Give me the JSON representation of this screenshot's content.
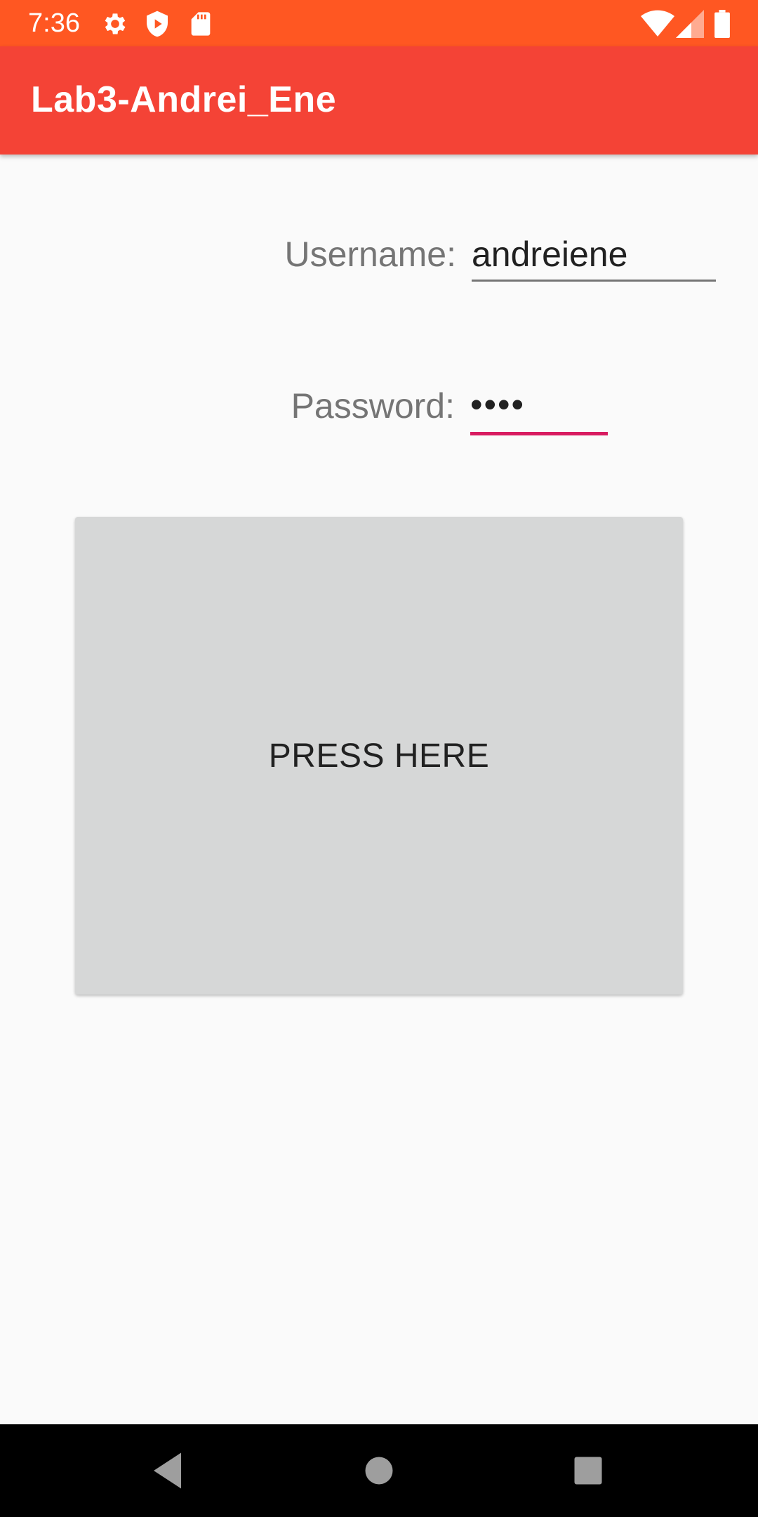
{
  "status_bar": {
    "time": "7:36",
    "icons_left": [
      "gear-icon",
      "shield-icon",
      "sd-card-icon"
    ],
    "icons_right": [
      "wifi-icon",
      "cellular-signal-icon",
      "battery-icon"
    ],
    "background": "#ff5722"
  },
  "app_bar": {
    "title": "Lab3-Andrei_Ene",
    "background": "#f44336"
  },
  "form": {
    "username_label": "Username:",
    "username_value": "andreiene",
    "password_label": "Password:",
    "password_value": "••••",
    "focused_underline_color": "#d81b60",
    "unfocused_underline_color": "#757575"
  },
  "button": {
    "label": "PRESS HERE",
    "background": "#d6d7d7"
  },
  "nav_bar": {
    "icons": [
      "back-icon",
      "home-icon",
      "recents-icon"
    ]
  }
}
